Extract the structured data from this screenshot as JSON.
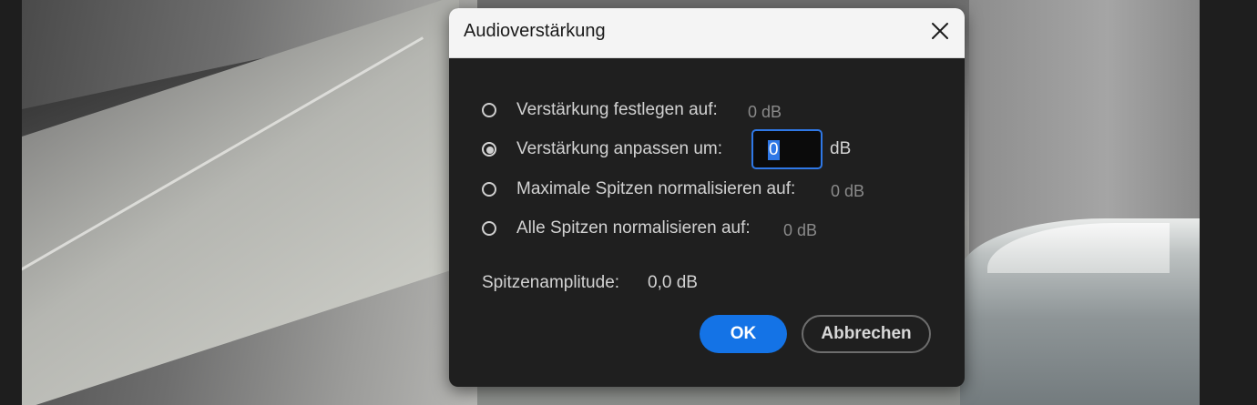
{
  "dialog": {
    "title": "Audioverstärkung",
    "close_icon": "close-icon",
    "options": [
      {
        "label": "Verstärkung festlegen auf:",
        "value": "0 dB",
        "checked": false
      },
      {
        "label": "Verstärkung anpassen um:",
        "value": "0",
        "unit": "dB",
        "checked": true
      },
      {
        "label": "Maximale Spitzen normalisieren auf:",
        "value": "0 dB",
        "checked": false
      },
      {
        "label": "Alle Spitzen normalisieren auf:",
        "value": "0 dB",
        "checked": false
      }
    ],
    "peak": {
      "label": "Spitzenamplitude:",
      "value": "0,0 dB"
    },
    "buttons": {
      "ok": "OK",
      "cancel": "Abbrechen"
    }
  },
  "colors": {
    "accent": "#1473e6",
    "dialog_bg": "#1f1f1f",
    "titlebar_bg": "#f4f4f4"
  }
}
